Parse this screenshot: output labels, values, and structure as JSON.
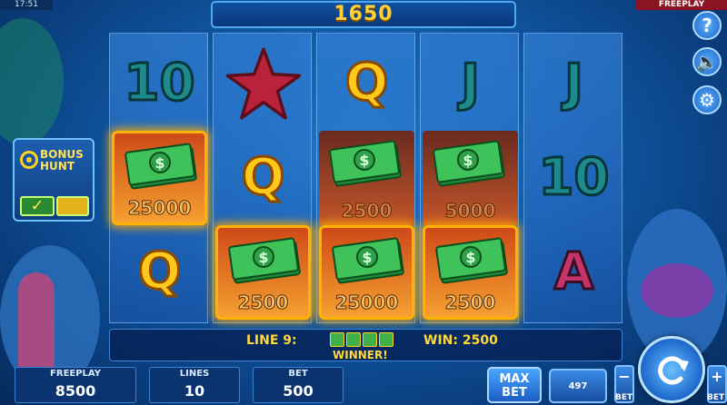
{
  "status": {
    "time": "17:51",
    "mode": "FREEPLAY"
  },
  "balance_display": "1650",
  "bonus_hunt": {
    "title_line1": "BONUS",
    "title_line2": "HUNT",
    "check_glyph": "✓"
  },
  "side_buttons": [
    {
      "name": "help-button",
      "glyph": "?",
      "icon": "question-icon"
    },
    {
      "name": "sound-button",
      "glyph": "🔈",
      "icon": "speaker-muted-icon"
    },
    {
      "name": "settings-button",
      "glyph": "⚙",
      "icon": "gear-icon"
    }
  ],
  "reels": [
    [
      {
        "symbol": "10",
        "style": "teal"
      },
      {
        "symbol": "cash",
        "value": "25000",
        "highlight": "win"
      },
      {
        "symbol": "Q",
        "style": "gold"
      }
    ],
    [
      {
        "symbol": "starfish"
      },
      {
        "symbol": "Q",
        "style": "gold"
      },
      {
        "symbol": "cash",
        "value": "2500",
        "highlight": "win"
      }
    ],
    [
      {
        "symbol": "Q",
        "style": "gold"
      },
      {
        "symbol": "cash",
        "value": "2500",
        "highlight": "dark"
      },
      {
        "symbol": "cash",
        "value": "25000",
        "highlight": "win"
      }
    ],
    [
      {
        "symbol": "J",
        "style": "teal"
      },
      {
        "symbol": "cash",
        "value": "5000",
        "highlight": "dark"
      },
      {
        "symbol": "cash",
        "value": "2500",
        "highlight": "win"
      }
    ],
    [
      {
        "symbol": "J",
        "style": "teal"
      },
      {
        "symbol": "10",
        "style": "teal"
      },
      {
        "symbol": "A",
        "style": "pink"
      }
    ]
  ],
  "win_info": {
    "line": "LINE 9:",
    "win": "WIN: 2500",
    "winner": "WINNER!"
  },
  "stats": {
    "freeplay_label": "FREEPLAY",
    "freeplay_value": "8500",
    "lines_label": "LINES",
    "lines_value": "10",
    "bet_label": "BET",
    "bet_value": "500"
  },
  "controls": {
    "max_label": "MAX",
    "bet_label": "BET",
    "auto_value": "497",
    "minus": "−",
    "plus": "+",
    "bet_small": "BET"
  },
  "colors": {
    "gold": "#ffd23a",
    "frame": "#4fa8f2",
    "win_border": "#ffb300"
  }
}
